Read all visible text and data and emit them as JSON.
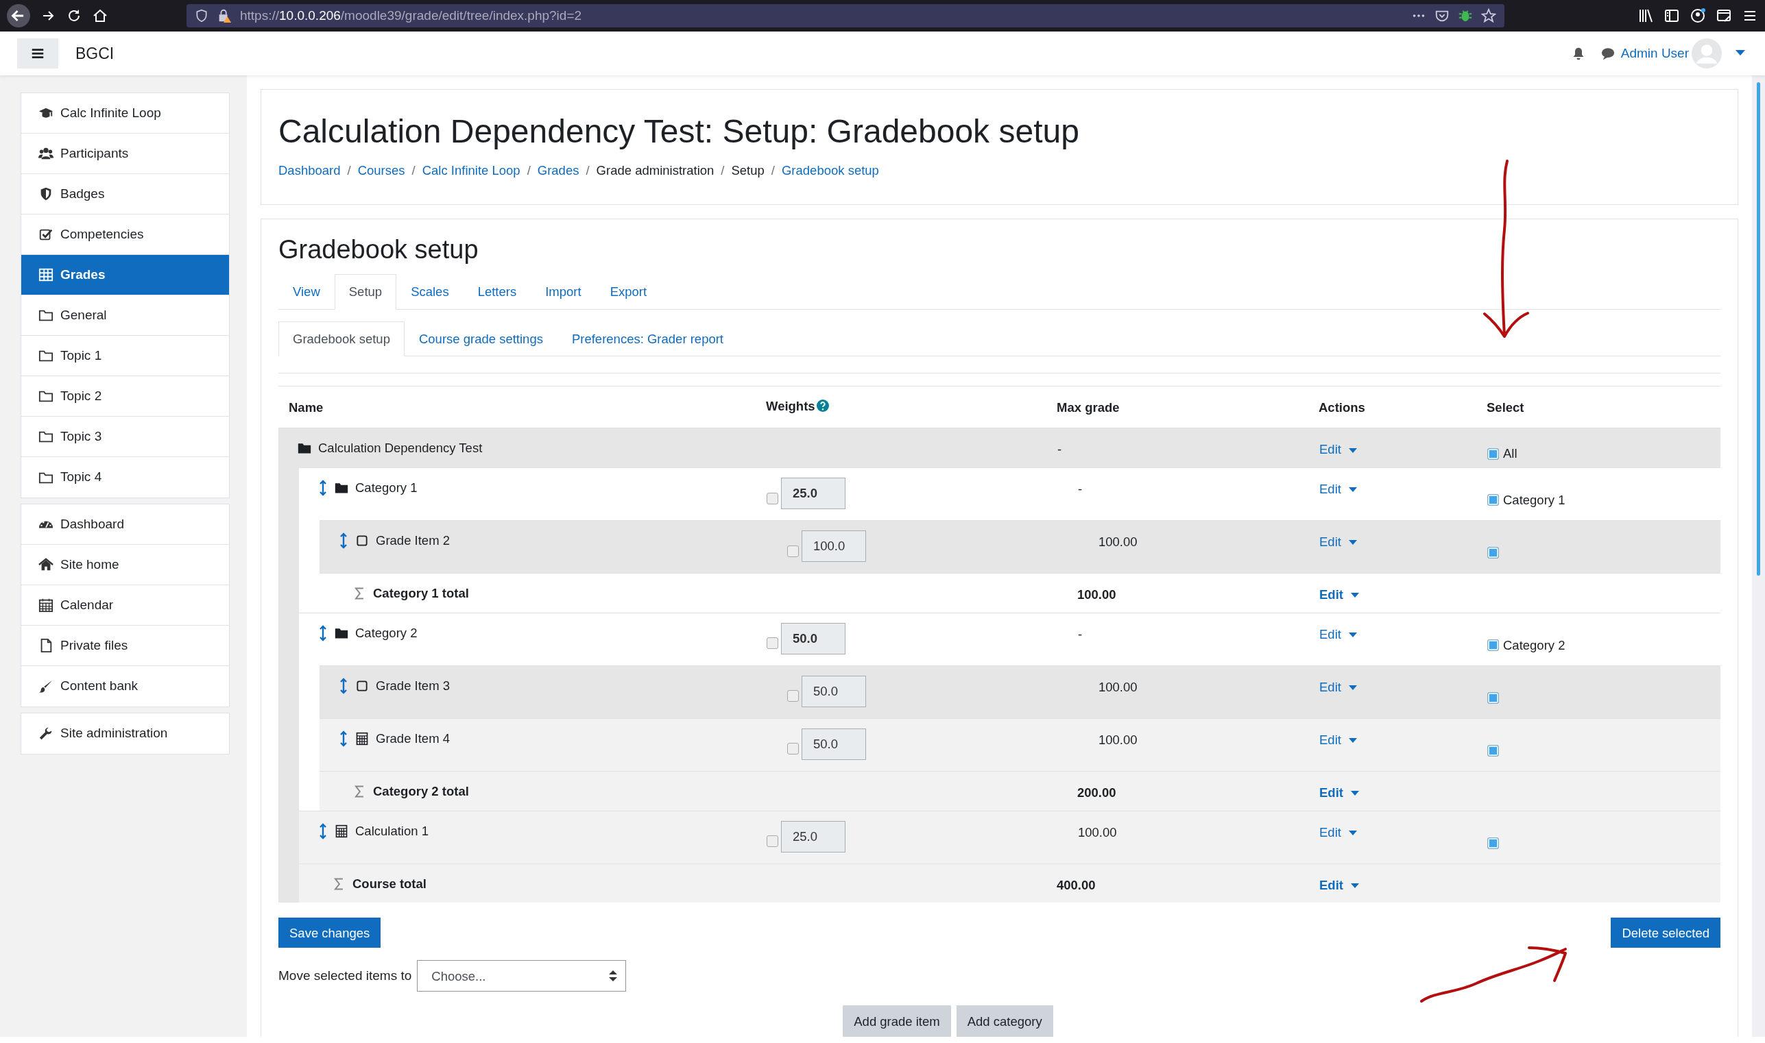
{
  "browser": {
    "url_scheme": "https://",
    "url_host": "10.0.0.206",
    "url_path": "/moodle39/grade/edit/tree/index.php?id=2"
  },
  "navbar": {
    "site_name": "BGCI",
    "user_name": "Admin User"
  },
  "sidebar": {
    "groups": [
      [
        {
          "label": "Calc Infinite Loop",
          "selected": false
        },
        {
          "label": "Participants",
          "selected": false
        },
        {
          "label": "Badges",
          "selected": false
        },
        {
          "label": "Competencies",
          "selected": false
        },
        {
          "label": "Grades",
          "selected": true
        },
        {
          "label": "General",
          "selected": false
        },
        {
          "label": "Topic 1",
          "selected": false
        },
        {
          "label": "Topic 2",
          "selected": false
        },
        {
          "label": "Topic 3",
          "selected": false
        },
        {
          "label": "Topic 4",
          "selected": false
        }
      ],
      [
        {
          "label": "Dashboard",
          "selected": false
        },
        {
          "label": "Site home",
          "selected": false
        },
        {
          "label": "Calendar",
          "selected": false
        },
        {
          "label": "Private files",
          "selected": false
        },
        {
          "label": "Content bank",
          "selected": false
        }
      ],
      [
        {
          "label": "Site administration",
          "selected": false
        }
      ]
    ]
  },
  "page_header": {
    "title": "Calculation Dependency Test: Setup: Gradebook setup",
    "separator": "/",
    "breadcrumbs": [
      {
        "label": "Dashboard",
        "link": true
      },
      {
        "label": "Courses",
        "link": true
      },
      {
        "label": "Calc Infinite Loop",
        "link": true
      },
      {
        "label": "Grades",
        "link": true
      },
      {
        "label": "Grade administration",
        "link": false
      },
      {
        "label": "Setup",
        "link": false
      },
      {
        "label": "Gradebook setup",
        "link": true
      }
    ]
  },
  "content": {
    "heading": "Gradebook setup",
    "tabs": [
      {
        "label": "View",
        "selected": false
      },
      {
        "label": "Setup",
        "selected": true
      },
      {
        "label": "Scales",
        "selected": false
      },
      {
        "label": "Letters",
        "selected": false
      },
      {
        "label": "Import",
        "selected": false
      },
      {
        "label": "Export",
        "selected": false
      }
    ],
    "subtabs": [
      {
        "label": "Gradebook setup",
        "selected": true
      },
      {
        "label": "Course grade settings",
        "selected": false
      },
      {
        "label": "Preferences: Grader report",
        "selected": false
      }
    ],
    "table": {
      "columns": [
        "Name",
        "Weights",
        "Max grade",
        "Actions",
        "Select"
      ],
      "rows": [
        {
          "name": "Calculation Dependency Test",
          "kind": "course",
          "max_grade": "-",
          "edit": "Edit",
          "select_checked": true,
          "select_label": "All",
          "children": [
            {
              "name": "Category 1",
              "kind": "category",
              "weight": "25.0",
              "weight_checked": false,
              "max_grade": "-",
              "edit": "Edit",
              "select_checked": true,
              "select_label": "Category 1",
              "children": [
                {
                  "name": "Grade Item 2",
                  "kind": "item",
                  "weight": "100.0",
                  "weight_checked": false,
                  "max_grade": "100.00",
                  "edit": "Edit",
                  "select_checked": true
                },
                {
                  "name": "Category 1 total",
                  "kind": "total",
                  "max_grade": "100.00",
                  "edit": "Edit"
                }
              ]
            },
            {
              "name": "Category 2",
              "kind": "category",
              "weight": "50.0",
              "weight_checked": false,
              "max_grade": "-",
              "edit": "Edit",
              "select_checked": true,
              "select_label": "Category 2",
              "children": [
                {
                  "name": "Grade Item 3",
                  "kind": "item",
                  "weight": "50.0",
                  "weight_checked": false,
                  "max_grade": "100.00",
                  "edit": "Edit",
                  "select_checked": true
                },
                {
                  "name": "Grade Item 4",
                  "kind": "calculated_item",
                  "weight": "50.0",
                  "weight_checked": false,
                  "max_grade": "100.00",
                  "edit": "Edit",
                  "select_checked": true
                },
                {
                  "name": "Category 2 total",
                  "kind": "total",
                  "max_grade": "200.00",
                  "edit": "Edit"
                }
              ]
            },
            {
              "name": "Calculation 1",
              "kind": "calculated_item",
              "weight": "25.0",
              "weight_checked": false,
              "max_grade": "100.00",
              "edit": "Edit",
              "select_checked": true
            },
            {
              "name": "Course total",
              "kind": "total",
              "max_grade": "400.00",
              "edit": "Edit"
            }
          ]
        }
      ]
    },
    "save_button": "Save changes",
    "delete_button": "Delete selected",
    "move": {
      "label": "Move selected items to",
      "select_value": "Choose..."
    },
    "buttons": [
      "Add grade item",
      "Add category"
    ]
  }
}
